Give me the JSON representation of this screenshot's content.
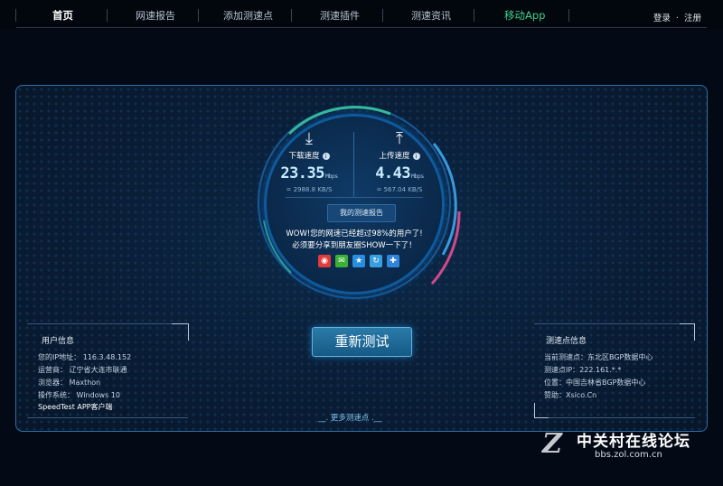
{
  "nav": {
    "items": [
      "首页",
      "网速报告",
      "添加测速点",
      "测速插件",
      "测速资讯",
      "移动App"
    ],
    "login": "登录",
    "sep": "·",
    "register": "注册"
  },
  "gauge": {
    "download": {
      "label": "下载速度",
      "value": "23.35",
      "unit": "Mbps",
      "kbs": "= 2988.8  KB/S"
    },
    "upload": {
      "label": "上传速度",
      "value": "4.43",
      "unit": "Mbps",
      "kbs": "= 567.04  KB/S"
    },
    "report_button": "我的测速报告",
    "wow_line1": "WOW!您的网速已经超过98%的用户了!",
    "wow_line2": "必须要分享到朋友圈SHOW一下了！",
    "share_icons": [
      "weibo-icon",
      "wechat-icon",
      "qzone-icon",
      "tencent-weibo-icon",
      "more-share-icon"
    ]
  },
  "retest_button": "重新测试",
  "more_points": "__. 更多测速点 .__",
  "user_info": {
    "title": "用户信息",
    "lines": [
      "您的IP地址： 116.3.48.152",
      "运营商： 辽宁省大连市联通",
      "浏览器： Maxthon",
      "操作系统： Windows 10",
      "SpeedTest APP客户端"
    ]
  },
  "test_point": {
    "title": "测速点信息",
    "lines": [
      "当前测速点：东北区BGP数据中心",
      "测速点IP：222.161.*.*",
      "位置：中国吉林省BGP数据中心",
      "赞助：Xsico.Cn"
    ]
  },
  "watermark": {
    "big": "中关村在线论坛",
    "small": "bbs.zol.com.cn",
    "logo": "Z"
  },
  "colors": {
    "accent_green": "#3fd08e",
    "panel_border": "#2f6ea5",
    "speed_text": "#c7ecff"
  }
}
